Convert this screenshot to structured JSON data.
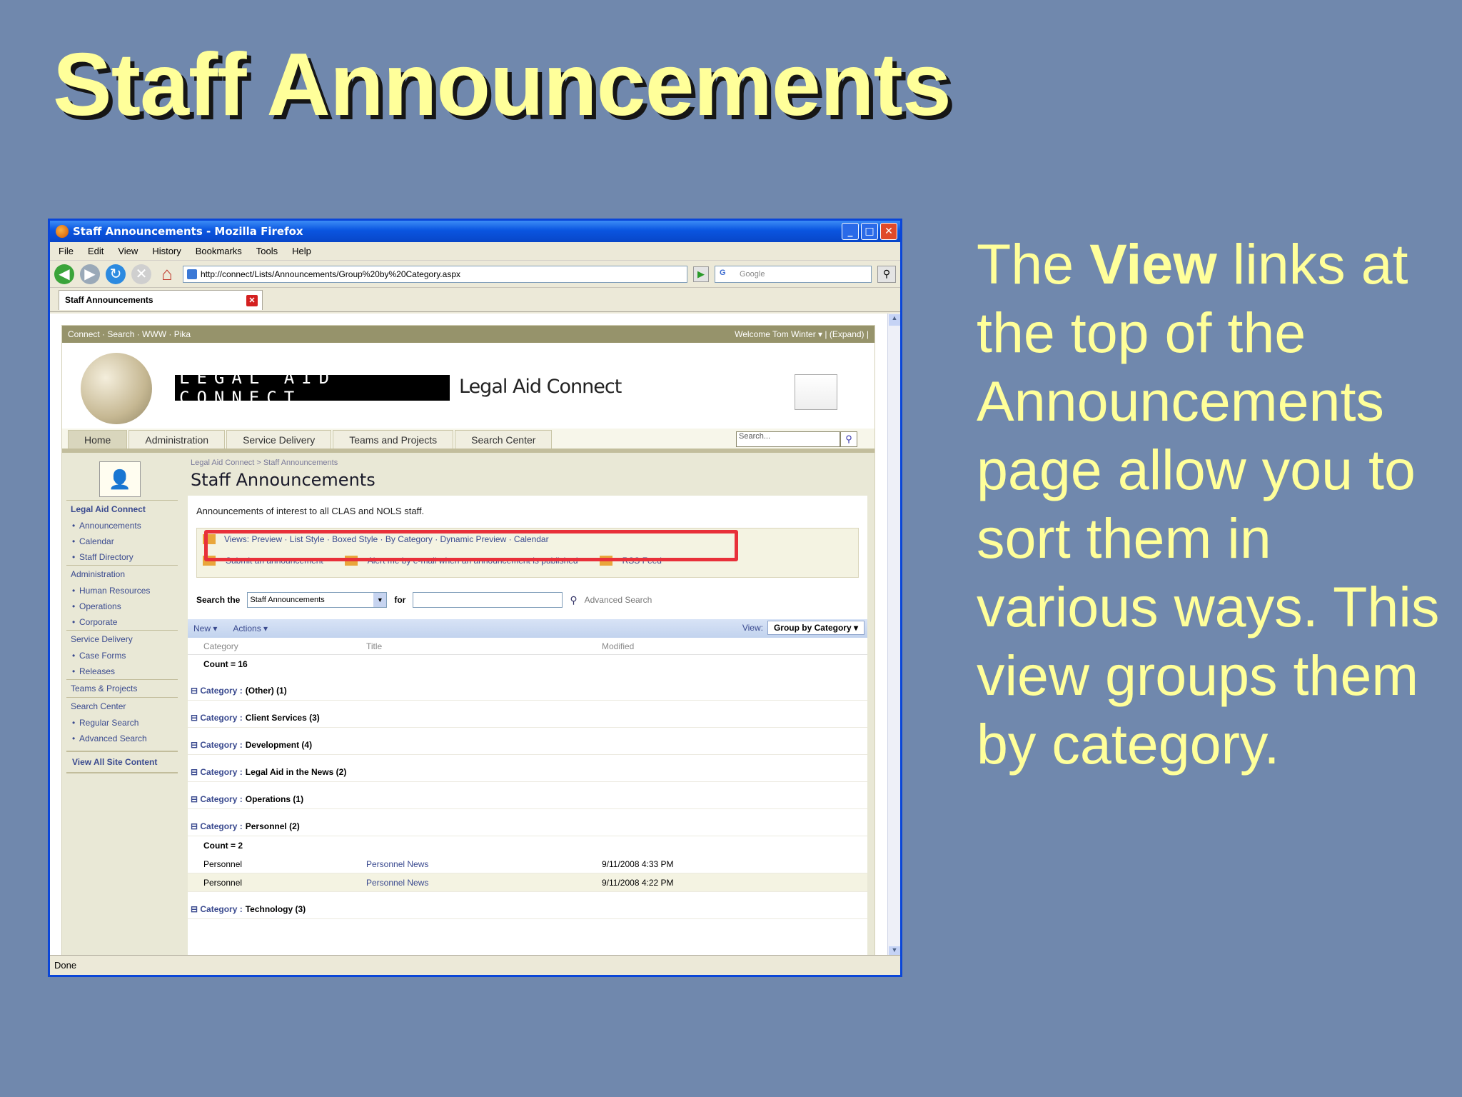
{
  "slide": {
    "title": "Staff Announcements",
    "body_pre": "The ",
    "body_bold": "View",
    "body_post": " links at the top of the Announcements page allow you to sort them in various ways. This view groups them by category."
  },
  "browser": {
    "window_title": "Staff Announcements - Mozilla Firefox",
    "menu": [
      "File",
      "Edit",
      "View",
      "History",
      "Bookmarks",
      "Tools",
      "Help"
    ],
    "url": "http://connect/Lists/Announcements/Group%20by%20Category.aspx",
    "search_placeholder": "Google",
    "tab_label": "Staff Announcements",
    "status": "Done"
  },
  "sharepoint": {
    "top_links": "Connect · Search · WWW · Pika",
    "welcome": "Welcome Tom Winter ▾  |  (Expand)  |",
    "logo_box": "LEGAL AID CONNECT",
    "logo_text": "Legal Aid Connect",
    "nav_tabs": [
      "Home",
      "Administration",
      "Service Delivery",
      "Teams and Projects",
      "Search Center"
    ],
    "search_placeholder": "Search...",
    "quick_launch": {
      "h1": "Legal Aid Connect",
      "h1_items": [
        "Announcements",
        "Calendar",
        "Staff Directory"
      ],
      "h2": "Administration",
      "h2_items": [
        "Human Resources",
        "Operations",
        "Corporate"
      ],
      "h3": "Service Delivery",
      "h3_items": [
        "Case Forms",
        "Releases"
      ],
      "h4": "Teams & Projects",
      "h5": "Search Center",
      "h5_items": [
        "Regular Search",
        "Advanced Search"
      ],
      "view_all": "View All Site Content"
    },
    "breadcrumb": "Legal Aid Connect > Staff Announcements",
    "page_title": "Staff Announcements",
    "description": "Announcements of interest to all CLAS and NOLS staff.",
    "views_line": "Views:  Preview  ·  List Style  ·  Boxed Style  ·  By Category  ·  Dynamic Preview  ·  Calendar",
    "actions": {
      "submit": "Submit an announcement",
      "alert": "Alert me by e-mail when an announcement is published",
      "rss": "RSS Feed"
    },
    "search_row": {
      "label": "Search the",
      "scope": "Staff Announcements",
      "for": "for",
      "advanced": "Advanced Search"
    },
    "list_toolbar": {
      "new": "New ▾",
      "actions": "Actions ▾",
      "view_label": "View:",
      "view_value": "Group by Category ▾"
    },
    "columns": [
      "Category",
      "Title",
      "Modified"
    ],
    "total_count": "Count = 16",
    "group_label": "⊟ Category :",
    "groups": [
      "(Other) (1)",
      "Client Services (3)",
      "Development (4)",
      "Legal Aid in the News (2)",
      "Operations (1)",
      "Personnel (2)",
      "Technology (3)"
    ],
    "personnel_count": "Count = 2",
    "rows": [
      {
        "category": "Personnel",
        "title": "Personnel News",
        "modified": "9/11/2008 4:33 PM"
      },
      {
        "category": "Personnel",
        "title": "Personnel News",
        "modified": "9/11/2008 4:22 PM"
      }
    ]
  }
}
